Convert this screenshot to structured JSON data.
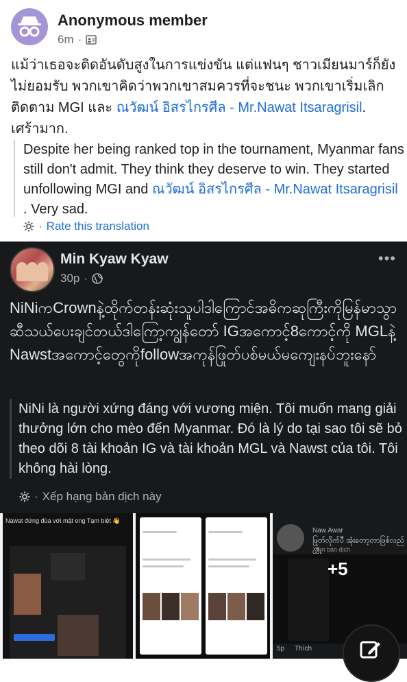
{
  "post_top": {
    "author": "Anonymous member",
    "time": "6m",
    "thai_text_part1": "แม้ว่าเธอจะติดอันดับสูงในการแข่งขัน แต่แฟนๆ ชาวเมียนมาร์ก็ยังไม่ยอมรับ  พวกเขาคิดว่าพวกเขาสมควรที่จะชนะ  พวกเขาเริ่มเลิกติดตาม MGI และ ",
    "thai_link": "ณวัฒน์ อิสรไกรศีล - Mr.Nawat Itsaragrisil",
    "thai_text_part2": ". เศร้ามาก.",
    "translation_part1": "Despite her being ranked top in the tournament, Myanmar fans still don't admit. They think they deserve to win. They started unfollowing MGI and ",
    "translation_link": "ณวัฒน์ อิสรไกรศีล - Mr.Nawat Itsaragrisil",
    "translation_part2": " . Very sad.",
    "rate_label": "Rate this translation"
  },
  "post_dark": {
    "author": "Min Kyaw Kyaw",
    "time": "30p",
    "myanmar_text": "NiNiကCrownနဲ့ထိုက်တန်းဆုံးသူပါဒါကြောင်အဓိကဆုကြီးကိုမြန်မာသွာဆီသယ်ပေးချင်တယ်ဒါကြော့ကျွန်တော် IGအကောင့်8ကောင့်ကို MGLနဲ့Nawstအကောင့်တွေကိုfollowအကုန်ဖြုတ်ပစ်မယ်မကျေးနပ်ဘူးနော်",
    "vietnamese_text": "NiNi là người xứng đáng với vương miện. Tôi muốn mang giải thưởng lớn cho mèo đến Myanmar. Đó là lý do tại sao tôi sẽ bỏ theo dõi 8 tài khoản IG và tài khoản MGL và Nawst của tôi. Tôi không hài lòng.",
    "rate_label": "Xếp hạng bản dịch này"
  },
  "gallery": {
    "thumb1_caption": "Nawat đứng đùa với mật ong Tạm biệt 👋",
    "thumb4_name": "Naw Awar",
    "thumb4_text": "ဖြုတ်လိုက်ပီ အုံးတော့တာဖြစ်လည် ယီး",
    "thumb4_sub": "Xem bản dịch",
    "more_count": "+5",
    "like_label": "Thích",
    "time_label": "5p"
  }
}
